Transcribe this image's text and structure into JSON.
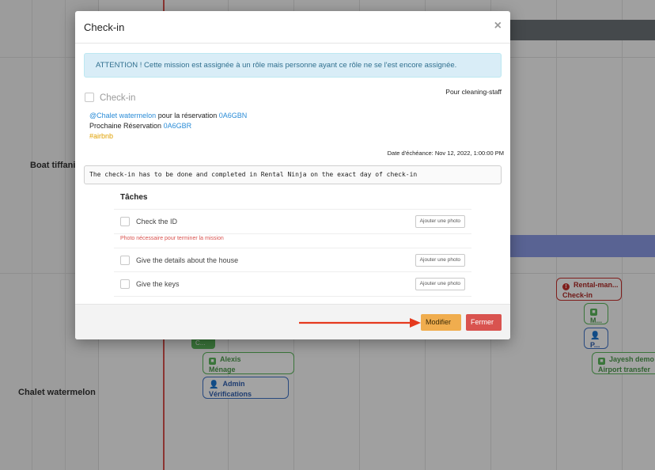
{
  "calendar": {
    "properties": [
      "Boat tiffanie",
      "Chalet watermelon"
    ],
    "chips": [
      {
        "name": "chip-rental-checkin",
        "style": "red",
        "icon": "alert-icon",
        "line1": "Rental-man...",
        "line2": "Check-in"
      },
      {
        "name": "chip-m",
        "style": "green",
        "icon": "task-icon",
        "line1": "",
        "line2": "M..."
      },
      {
        "name": "chip-p",
        "style": "blue",
        "icon": "user-plus-icon",
        "line1": "",
        "line2": "P..."
      },
      {
        "name": "chip-c",
        "style": "green-solid",
        "line1": "C..."
      },
      {
        "name": "chip-alexis",
        "style": "green",
        "icon": "task-icon",
        "line1": "Alexis",
        "line2": "Ménage"
      },
      {
        "name": "chip-admin",
        "style": "blue",
        "icon": "user-plus-icon",
        "line1": "Admin",
        "line2": "Vérifications"
      },
      {
        "name": "chip-jayesh",
        "style": "green",
        "icon": "task-icon",
        "line1": "Jayesh demo",
        "line2": "Airport transfer"
      }
    ]
  },
  "modal": {
    "title": "Check-in",
    "close_glyph": "×",
    "alert": "ATTENTION ! Cette mission est assignée à un rôle mais personne ayant ce rôle ne se l'est encore assignée.",
    "for_staff": "Pour cleaning-staff",
    "mission_label": "Check-in",
    "property_link": "@Chalet watermelon",
    "reservation_text": "pour la réservation",
    "reservation_code": "0A6GBN",
    "next_res_text": "Prochaine Réservation",
    "next_res_code": "0A6GBR",
    "source_tag": "#airbnb",
    "due_date": "Date d'échéance: Nov 12, 2022, 1:00:00 PM",
    "note": "The check-in has to be done and completed in Rental Ninja on the exact day of check-in",
    "tasks_title": "Tâches",
    "tasks": [
      {
        "label": "Check the ID",
        "button": "Ajouter une photo",
        "warning": "Photo nécessaire pour terminer la mission"
      },
      {
        "label": "Give the details about the house",
        "button": "Ajouter une photo"
      },
      {
        "label": "Give the keys",
        "button": "Ajouter une photo"
      }
    ],
    "footer": {
      "modify": "Modifier",
      "close": "Fermer"
    }
  },
  "colors": {
    "accent_warning": "#f0ad4e",
    "danger": "#d9534f",
    "link": "#2a8cd7",
    "annotation_arrow": "#e53a1e"
  }
}
